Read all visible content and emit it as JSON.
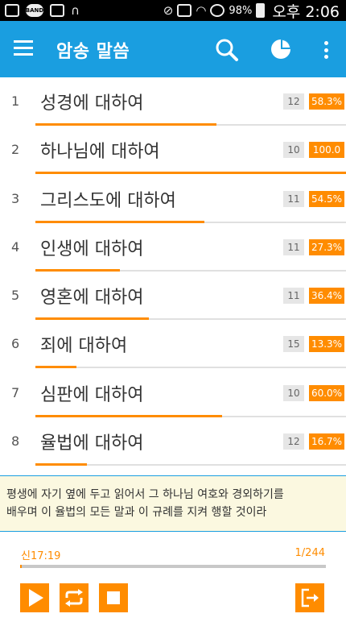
{
  "status_bar": {
    "icons": [
      "image-icon",
      "band-icon",
      "blocked-notification-icon",
      "headset-icon",
      "mute-icon",
      "nfc-icon",
      "wifi-icon",
      "no-sim-icon",
      "battery-icon"
    ],
    "band_label": "BAND",
    "battery": "98%",
    "time": "오후 2:06"
  },
  "app_bar": {
    "title": "암송 말씀",
    "icons": [
      "menu-icon",
      "search-icon",
      "pie-chart-icon",
      "more-vert-icon"
    ],
    "color": "#1a9ee0"
  },
  "list": {
    "accent_color": "#ff8c00",
    "items": [
      {
        "num": "1",
        "title": "성경에 대하여",
        "count": "12",
        "percent": "58.3%",
        "progress": 0.583
      },
      {
        "num": "2",
        "title": "하나님에 대하여",
        "count": "10",
        "percent": "100.0",
        "progress": 1.0
      },
      {
        "num": "3",
        "title": "그리스도에 대하여",
        "count": "11",
        "percent": "54.5%",
        "progress": 0.545
      },
      {
        "num": "4",
        "title": "인생에 대하여",
        "count": "11",
        "percent": "27.3%",
        "progress": 0.273
      },
      {
        "num": "5",
        "title": "영혼에 대하여",
        "count": "11",
        "percent": "36.4%",
        "progress": 0.364
      },
      {
        "num": "6",
        "title": "죄에 대하여",
        "count": "15",
        "percent": "13.3%",
        "progress": 0.133
      },
      {
        "num": "7",
        "title": "심판에 대하여",
        "count": "10",
        "percent": "60.0%",
        "progress": 0.6
      },
      {
        "num": "8",
        "title": "율법에 대하여",
        "count": "12",
        "percent": "16.7%",
        "progress": 0.167
      }
    ]
  },
  "verse": {
    "line1": "평생에 자기 옆에 두고 읽어서 그 하나님 여호와 경외하기를",
    "line2": "배우며 이 율법의 모든 말과 이 규례를 지켜 행할 것이라"
  },
  "player": {
    "reference": "신17:19",
    "position": "1/244",
    "progress": 0.004,
    "buttons": [
      "play-icon",
      "repeat-icon",
      "stop-icon",
      "exit-icon"
    ]
  }
}
